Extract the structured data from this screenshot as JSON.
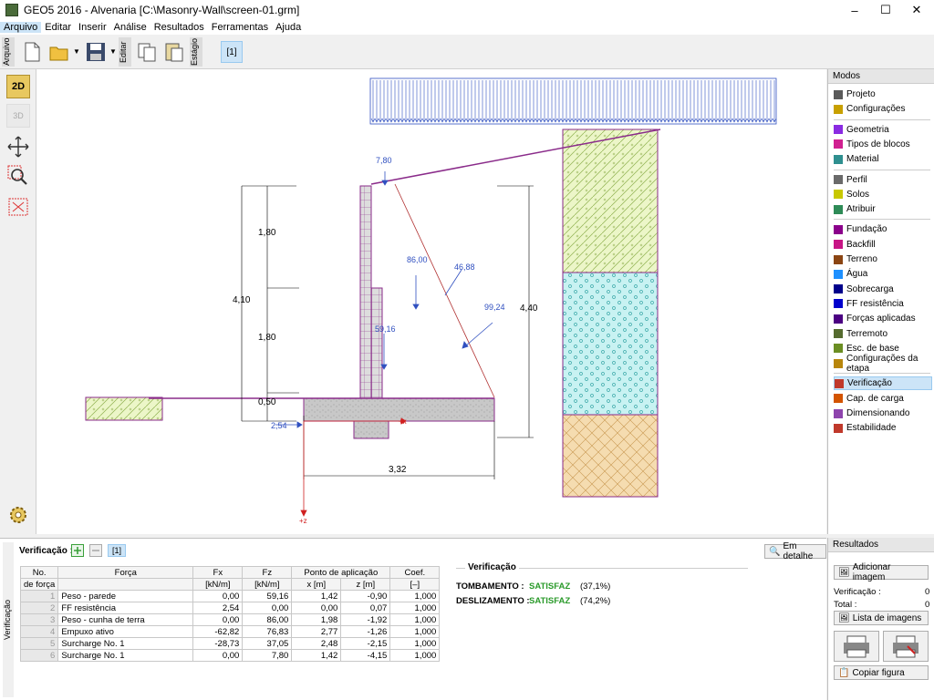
{
  "window": {
    "title": "GEO5 2016 - Alvenaria [C:\\Masonry-Wall\\screen-01.grm]"
  },
  "menu": [
    "Arquivo",
    "Editar",
    "Inserir",
    "Análise",
    "Resultados",
    "Ferramentas",
    "Ajuda"
  ],
  "toolbar": {
    "arquivo_label": "Arquivo",
    "editar_label": "Editar",
    "estagio_label": "Estágio",
    "stage": "[1]"
  },
  "left_tools": {
    "mode_2d": "2D",
    "mode_3d": "3D"
  },
  "canvas": {
    "dims": {
      "d_180a": "1,80",
      "d_180b": "1,80",
      "d_050": "0,50",
      "d_410": "4,10",
      "d_440": "4,40",
      "d_332": "3,32",
      "d_254": "2,54",
      "f_780": "7,80",
      "f_8600": "86,00",
      "f_4688": "46,88",
      "f_9924": "99,24",
      "f_5916": "59,16"
    },
    "axes": {
      "x": "+x",
      "z": "+z"
    }
  },
  "modes": {
    "header": "Modos",
    "items": [
      {
        "label": "Projeto",
        "color": "#5a5a5a"
      },
      {
        "label": "Configurações",
        "color": "#c8a000"
      },
      {
        "label": "Geometria",
        "color": "#8a2be2"
      },
      {
        "label": "Tipos de blocos",
        "color": "#d02090"
      },
      {
        "label": "Material",
        "color": "#2f8f8f"
      },
      {
        "label": "Perfil",
        "color": "#6a6a6a"
      },
      {
        "label": "Solos",
        "color": "#c8c800"
      },
      {
        "label": "Atribuir",
        "color": "#2e8b57"
      },
      {
        "label": "Fundação",
        "color": "#8b008b"
      },
      {
        "label": "Backfill",
        "color": "#c71585"
      },
      {
        "label": "Terreno",
        "color": "#8b4513"
      },
      {
        "label": "Água",
        "color": "#1e90ff"
      },
      {
        "label": "Sobrecarga",
        "color": "#00008b"
      },
      {
        "label": "FF resistência",
        "color": "#0000cd"
      },
      {
        "label": "Forças aplicadas",
        "color": "#4b0082"
      },
      {
        "label": "Terremoto",
        "color": "#556b2f"
      },
      {
        "label": "Esc. de base",
        "color": "#6b8e23"
      },
      {
        "label": "Configurações da etapa",
        "color": "#b8860b"
      },
      {
        "label": "Verificação",
        "color": "#c0392b"
      },
      {
        "label": "Cap. de carga",
        "color": "#d35400"
      },
      {
        "label": "Dimensionando",
        "color": "#8e44ad"
      },
      {
        "label": "Estabilidade",
        "color": "#c0392b"
      }
    ]
  },
  "bottom": {
    "side_label": "Verificação",
    "header": "Verificação :",
    "stage": "[1]",
    "detail_button": "Em detalhe",
    "columns": {
      "no": "No.",
      "no2": "de força",
      "forca": "Força",
      "fx": "Fx",
      "fx_unit": "[kN/m]",
      "fz": "Fz",
      "fz_unit": "[kN/m]",
      "ponto": "Ponto de aplicação",
      "x": "x [m]",
      "z": "z [m]",
      "coef": "Coef.",
      "coef_unit": "[–]"
    },
    "rows": [
      {
        "n": "1",
        "forca": "Peso - parede",
        "fx": "0,00",
        "fz": "59,16",
        "x": "1,42",
        "z": "-0,90",
        "coef": "1,000"
      },
      {
        "n": "2",
        "forca": "FF resistência",
        "fx": "2,54",
        "fz": "0,00",
        "x": "0,00",
        "z": "0,07",
        "coef": "1,000"
      },
      {
        "n": "3",
        "forca": "Peso - cunha de terra",
        "fx": "0,00",
        "fz": "86,00",
        "x": "1,98",
        "z": "-1,92",
        "coef": "1,000"
      },
      {
        "n": "4",
        "forca": "Empuxo ativo",
        "fx": "-62,82",
        "fz": "76,83",
        "x": "2,77",
        "z": "-1,26",
        "coef": "1,000"
      },
      {
        "n": "5",
        "forca": "Surcharge No. 1",
        "fx": "-28,73",
        "fz": "37,05",
        "x": "2,48",
        "z": "-2,15",
        "coef": "1,000"
      },
      {
        "n": "6",
        "forca": "Surcharge No. 1",
        "fx": "0,00",
        "fz": "7,80",
        "x": "1,42",
        "z": "-4,15",
        "coef": "1,000"
      }
    ],
    "verification": {
      "title": "Verificação",
      "lines": [
        {
          "label": "TOMBAMENTO :",
          "status": "SATISFAZ",
          "pct": "(37,1%)"
        },
        {
          "label": "DESLIZAMENTO :",
          "status": "SATISFAZ",
          "pct": "(74,2%)"
        }
      ]
    }
  },
  "results": {
    "header": "Resultados",
    "add_image": "Adicionar imagem",
    "verificacao_label": "Verificação :",
    "verificacao_val": "0",
    "total_label": "Total :",
    "total_val": "0",
    "image_list": "Lista de imagens",
    "copy_figure": "Copiar figura"
  }
}
